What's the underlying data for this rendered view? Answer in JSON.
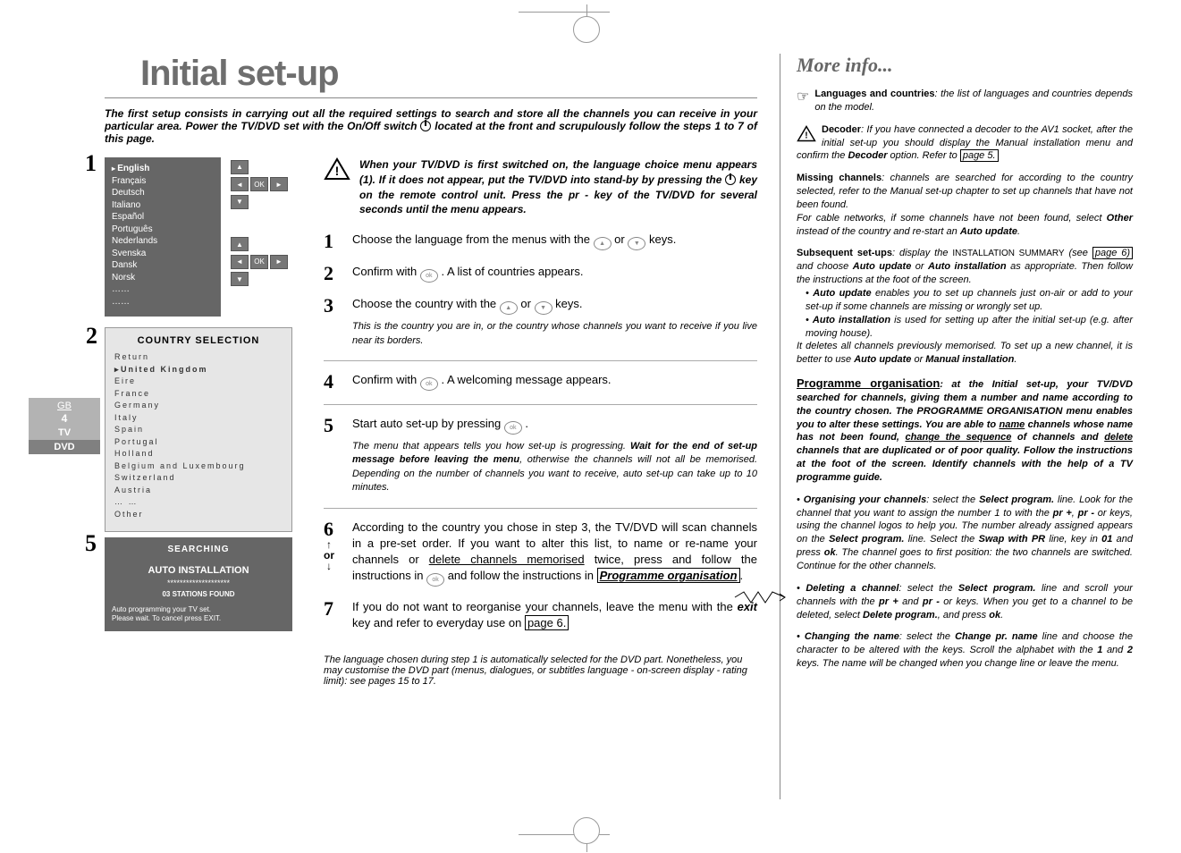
{
  "tabs": {
    "gb": "GB",
    "page": "4",
    "tv": "TV",
    "dvd": "DVD"
  },
  "title": "Initial set-up",
  "intro_a": "The first setup consists in carrying out all the required settings to search and store all the channels you can receive in your particular area. Power the TV/DVD set with the On/Off switch ",
  "intro_b": " located at the front and scrupulously follow the steps 1 to 7 of this page.",
  "lang_menu": {
    "items": [
      "English",
      "Français",
      "Deutsch",
      "Italiano",
      "Español",
      "Português",
      "Nederlands",
      "Svenska",
      "Dansk",
      "Norsk",
      "……",
      "……"
    ],
    "ok": "OK"
  },
  "note1_a": "When your TV/DVD is first switched on, the language choice menu appears (1). If it does not appear, put the TV/DVD into stand-by by pressing the ",
  "note1_b": " key on the remote control unit. Press the pr - key of the TV/DVD for several seconds until the menu appears.",
  "steps": {
    "s1": "Choose the language from the menus with the   or   keys.",
    "s2": "Confirm with  . A list of countries appears.",
    "s3": "Choose the country with the   or   keys.",
    "s3_sub": "This is the country you are in, or the country whose channels you want to receive if you live near its borders.",
    "s4": "Confirm with  . A welcoming message appears.",
    "s5": "Start auto set-up by pressing  .",
    "s5_sub1": "The menu that appears tells you how set-up is progressing. ",
    "s5_sub1b": "Wait for the end of set-up message before leaving the menu",
    "s5_sub1c": ", otherwise the channels will not all be memorised. Depending on the number of channels you want to receive, auto set-up can take up to 10 minutes.",
    "s6_a": "According to the country you chose in step 3, the TV/DVD will scan channels in a pre-set order. If you want to alter this list, to name or re-name your channels or ",
    "s6_b": "delete channels memorised",
    "s6_c": " twice, press   and follow the instructions in ",
    "s6_link": "Programme organisation",
    "s6_d": ".",
    "or": "or",
    "s7_a": "If you do not want to reorganise your channels, leave the menu with the ",
    "s7_b": "exit",
    "s7_c": " key and refer to everyday use on ",
    "s7_link": "page 6.",
    "final": "The language chosen during step 1 is automatically selected for the DVD part. Nonetheless, you may customise the DVD part (menus, dialogues, or subtitles language - on-screen display - rating limit): see pages 15 to 17."
  },
  "country_menu": {
    "title": "COUNTRY SELECTION",
    "items": [
      "Return",
      "United Kingdom",
      "Eire",
      "France",
      "Germany",
      "Italy",
      "Spain",
      "Portugal",
      "Holland",
      "Belgium and Luxembourg",
      "Switzerland",
      "Austria",
      "… …",
      "Other"
    ]
  },
  "search_menu": {
    "title": "SEARCHING",
    "auto": "AUTO INSTALLATION",
    "dots": "********************",
    "found": "03 STATIONS FOUND",
    "msg": "Auto programming your TV set.\nPlease wait. To cancel press EXIT."
  },
  "more": {
    "title": "More info...",
    "lang_a": "Languages and countries",
    "lang_b": ": the list of languages and countries depends on the model.",
    "dec_a": "Decoder",
    "dec_b": ": If you have connected a decoder to the AV1 socket, after the initial set-up you should display the Manual installation menu and confirm the ",
    "dec_c": "Decoder",
    "dec_d": " option. Refer to ",
    "dec_link": "page 5.",
    "miss_a": "Missing channels",
    "miss_b": ": channels are searched for according to the country selected, refer to the Manual set-up chapter to set up channels that have not been found.",
    "miss_c": "For cable networks, if some channels have not been found, select ",
    "miss_d": "Other",
    "miss_e": " instead of the country and re-start an ",
    "miss_f": "Auto update",
    "miss_g": ".",
    "sub_a": "Subsequent set-ups",
    "sub_b": ": display the ",
    "sub_c": "INSTALLATION SUMMARY",
    "sub_d": " (see ",
    "sub_link": "page 6)",
    "sub_e": " and choose ",
    "sub_f": "Auto update",
    "sub_g": " or ",
    "sub_h": "Auto installation",
    "sub_i": " as appropriate. Then follow the instructions at the foot of the screen.",
    "sub_j": "Auto update",
    "sub_k": " enables you to set up channels just on-air or add to your set-up if some channels are missing or wrongly set up.",
    "sub_l": "Auto installation",
    "sub_m": " is used for setting up after the initial set-up (e.g. after moving house).",
    "sub_n": "It deletes all channels previously memorised. To set up a new channel, it is better to use ",
    "sub_o": "Auto update",
    "sub_p": " or ",
    "sub_q": "Manual installation",
    "sub_r": ".",
    "prog_h": "Programme organisation",
    "prog_a": ": at the Initial set-up, your TV/DVD searched for channels, giving them a number and name according to the country chosen. The PROGRAMME ORGANISATION menu enables you to alter these settings. You are able to ",
    "prog_b": "name",
    "prog_c": " channels whose name has not been found, ",
    "prog_d": "change the sequence",
    "prog_e": " of channels and ",
    "prog_f": "delete",
    "prog_g2": " channels that are duplicated or of poor quality. Follow the instructions at the foot of the screen. Identify channels with the help of a TV programme guide.",
    "org_a": "Organising your channels",
    "org_b": ": select the ",
    "org_c": "Select program.",
    "org_d": " line. Look for the channel that you want to assign the number 1 to with the ",
    "org_e": "pr +",
    "org_f": ", ",
    "org_g": "pr -",
    "org_h": " or   keys, using the channel logos to help you. The number already assigned appears on the ",
    "org_i": "Select program.",
    "org_j": " line. Select the ",
    "org_k": "Swap with PR",
    "org_l": " line, key in ",
    "org_m": "01",
    "org_n": " and press ",
    "org_o": "ok",
    "org_p": ". The channel goes to first position: the two channels are switched. Continue for the other channels.",
    "del_a": "Deleting a channel",
    "del_b": ": select the ",
    "del_c": "Select program.",
    "del_d": " line and scroll your channels with the ",
    "del_e": "pr +",
    "del_f": " and ",
    "del_g": "pr -",
    "del_h": " or   keys. When you get to a channel to be deleted, select ",
    "del_i": "Delete program.",
    "del_j": ", and press ",
    "del_k": "ok",
    "del_l": ".",
    "chg_a": "Changing the name",
    "chg_b": ": select the ",
    "chg_c": "Change pr. name",
    "chg_d": " line and choose the character to be altered with the   keys. Scroll the alphabet with the ",
    "chg_e": "1",
    "chg_f": " and ",
    "chg_g": "2",
    "chg_h": " keys. The name will be changed when you change line or leave the menu."
  }
}
